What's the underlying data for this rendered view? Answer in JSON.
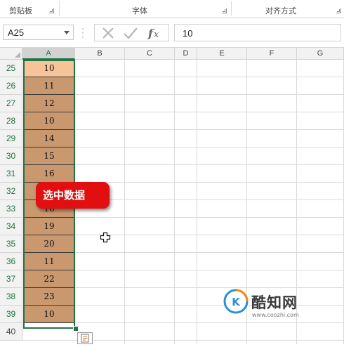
{
  "ribbon": {
    "groups": [
      {
        "label": "剪贴板"
      },
      {
        "label": "字体"
      },
      {
        "label": "对齐方式"
      }
    ]
  },
  "formula_bar": {
    "name_box": "A25",
    "formula_value": "10",
    "icons": [
      "cancel-icon",
      "enter-icon",
      "function-icon"
    ]
  },
  "sheet": {
    "columns": [
      "A",
      "B",
      "C",
      "D",
      "E",
      "F",
      "G"
    ],
    "selected_column": "A",
    "rows": [
      {
        "row": "25",
        "a": "10"
      },
      {
        "row": "26",
        "a": "11"
      },
      {
        "row": "27",
        "a": "12"
      },
      {
        "row": "28",
        "a": "10"
      },
      {
        "row": "29",
        "a": "14"
      },
      {
        "row": "30",
        "a": "15"
      },
      {
        "row": "31",
        "a": "16"
      },
      {
        "row": "32",
        "a": ""
      },
      {
        "row": "33",
        "a": "18"
      },
      {
        "row": "34",
        "a": "19"
      },
      {
        "row": "35",
        "a": "20"
      },
      {
        "row": "36",
        "a": "11"
      },
      {
        "row": "37",
        "a": "22"
      },
      {
        "row": "38",
        "a": "23"
      },
      {
        "row": "39",
        "a": "10"
      }
    ],
    "extra_row": "40"
  },
  "callout": {
    "text": "选中数据",
    "color": "#e10f0f"
  },
  "colors": {
    "selection": "#217346",
    "cell_fill": "#c9986f",
    "active_fill": "#f7c49a"
  },
  "watermark": {
    "name": "酷知网",
    "url": "www.coozhi.com",
    "logo_text": "K"
  }
}
